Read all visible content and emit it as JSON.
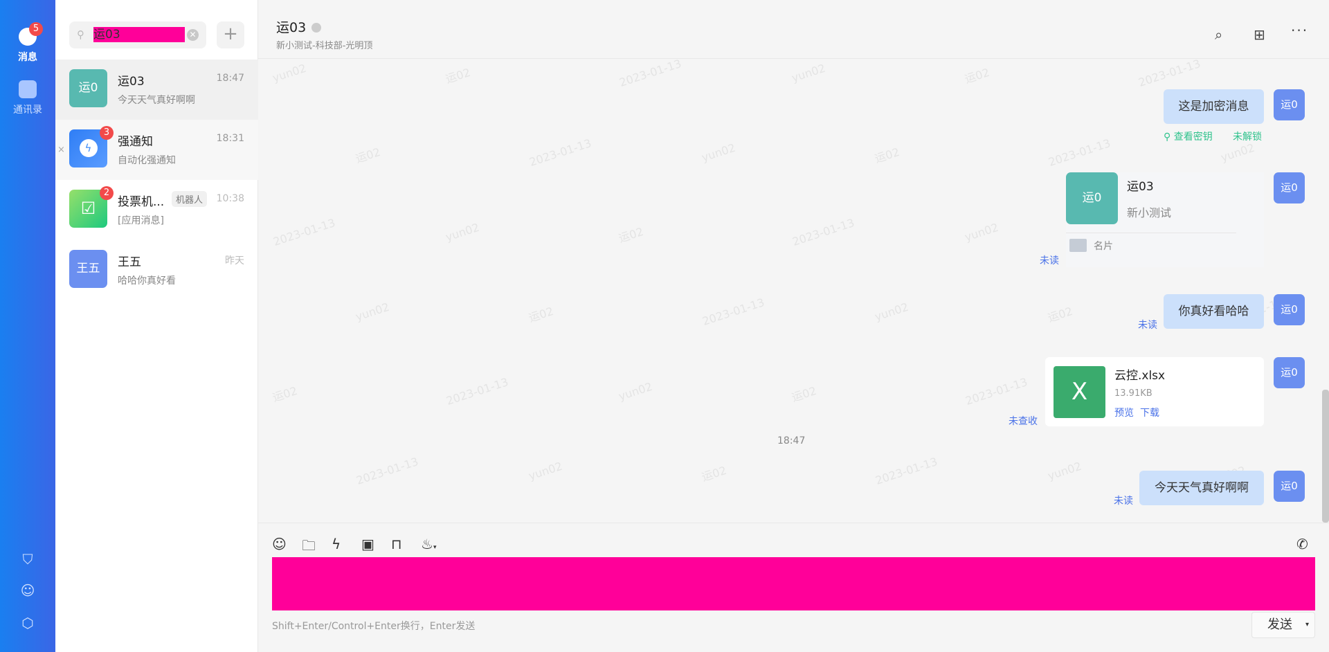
{
  "nav": {
    "messages": {
      "label": "消息",
      "badge": "5"
    },
    "contacts": {
      "label": "通讯录"
    },
    "bottom_icons": [
      "bookmark-icon",
      "robot-icon",
      "settings-icon"
    ]
  },
  "search": {
    "value": "运03",
    "plus": "+"
  },
  "conversations": [
    {
      "avatar": "运0",
      "name": "运03",
      "time": "18:47",
      "preview": "今天天气真好啊啊",
      "color": "#58b9b0"
    },
    {
      "name": "强通知",
      "time": "18:31",
      "preview": "自动化强通知",
      "badge": "3",
      "color": "#3f8cf7",
      "close": "×"
    },
    {
      "name": "投票机...",
      "tag": "机器人",
      "time": "10:38",
      "preview": "[应用消息]",
      "badge": "2",
      "color": "#4dd07a"
    },
    {
      "avatar": "王五",
      "name": "王五",
      "time": "昨天",
      "preview": "哈哈你真好看",
      "color": "#6b8ff0"
    }
  ],
  "header": {
    "title": "运03",
    "subtitle": "新小测试-科技部-光明顶"
  },
  "watermark": {
    "a": "yun02",
    "b": "运02",
    "c": "2023-01-13"
  },
  "messages": {
    "my_avatar": "运0",
    "encrypted": {
      "text": "这是加密消息",
      "view_key": "查看密钥",
      "status": "未解锁"
    },
    "card": {
      "avatar": "运0",
      "name": "运03",
      "org": "新小测试",
      "type": "名片",
      "read": "未读"
    },
    "text1": {
      "text": "你真好看哈哈",
      "read": "未读"
    },
    "file": {
      "icon": "X",
      "name": "云控.xlsx",
      "size": "13.91KB",
      "preview": "预览",
      "download": "下载",
      "status": "未查收"
    },
    "time": "18:47",
    "text2": {
      "text": "今天天气真好啊啊",
      "read": "未读"
    }
  },
  "composer": {
    "hint": "Shift+Enter/Control+Enter换行，Enter发送",
    "send": "发送"
  }
}
